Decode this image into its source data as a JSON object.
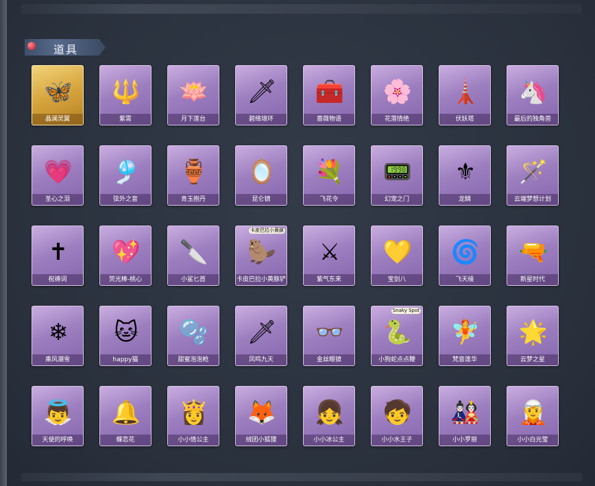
{
  "section": {
    "title": "道具"
  },
  "items": [
    {
      "label": "晶澜灵翼",
      "icon": "crystal-wings-icon",
      "glyph": "🦋",
      "rarity": "gold"
    },
    {
      "label": "紫霄",
      "icon": "pendant-icon",
      "glyph": "🔱",
      "rarity": "purple"
    },
    {
      "label": "月下莲台",
      "icon": "lotus-scepter-icon",
      "glyph": "🪷",
      "rarity": "purple"
    },
    {
      "label": "碧络琅环",
      "icon": "jade-sword-icon",
      "glyph": "🗡",
      "rarity": "purple"
    },
    {
      "label": "蔷薇物语",
      "icon": "rose-box-icon",
      "glyph": "🧰",
      "rarity": "purple"
    },
    {
      "label": "花落情绝",
      "icon": "flower-pendant-icon",
      "glyph": "🌸",
      "rarity": "purple"
    },
    {
      "label": "伏妖塔",
      "icon": "pagoda-icon",
      "glyph": "🗼",
      "rarity": "purple"
    },
    {
      "label": "最后的独角兽",
      "icon": "unicorn-horn-icon",
      "glyph": "🦄",
      "rarity": "purple"
    },
    {
      "label": "圣心之泪",
      "icon": "heart-scepter-icon",
      "glyph": "💗",
      "rarity": "purple"
    },
    {
      "label": "弦外之音",
      "icon": "flute-icon",
      "glyph": "🎐",
      "rarity": "purple"
    },
    {
      "label": "青玉抱丹",
      "icon": "jade-vase-icon",
      "glyph": "🏺",
      "rarity": "purple"
    },
    {
      "label": "昆仑镜",
      "icon": "mirror-icon",
      "glyph": "🪞",
      "rarity": "purple"
    },
    {
      "label": "飞花令",
      "icon": "flower-bouquet-icon",
      "glyph": "💐",
      "rarity": "purple"
    },
    {
      "label": "幻宠之门",
      "icon": "tamagotchi-icon",
      "glyph": "📟",
      "rarity": "purple"
    },
    {
      "label": "龙鳞",
      "icon": "golden-spade-icon",
      "glyph": "⚜",
      "rarity": "purple"
    },
    {
      "label": "云端梦想计划",
      "icon": "crystal-wand-icon",
      "glyph": "🪄",
      "rarity": "purple"
    },
    {
      "label": "祝祷词",
      "icon": "golden-cross-icon",
      "glyph": "✝",
      "rarity": "purple"
    },
    {
      "label": "荧光棒-桃心",
      "icon": "heart-glowstick-icon",
      "glyph": "💖",
      "rarity": "purple"
    },
    {
      "label": "小鲨匕首",
      "icon": "shark-dagger-icon",
      "glyph": "🔪",
      "rarity": "purple"
    },
    {
      "label": "卡皮巴拉小黄豚铲",
      "icon": "capybara-shovel-icon",
      "glyph": "🦫",
      "rarity": "purple",
      "badge": "卡皮巴拉小黄豚"
    },
    {
      "label": "紫气东来",
      "icon": "curved-sword-icon",
      "glyph": "⚔",
      "rarity": "purple"
    },
    {
      "label": "宝剑八",
      "icon": "heart-card-icon",
      "glyph": "💛",
      "rarity": "purple"
    },
    {
      "label": "飞天绫",
      "icon": "ribbon-whip-icon",
      "glyph": "🌀",
      "rarity": "purple"
    },
    {
      "label": "新星时代",
      "icon": "revolver-icon",
      "glyph": "🔫",
      "rarity": "purple"
    },
    {
      "label": "乘风潮雪",
      "icon": "ice-wings-icon",
      "glyph": "❄",
      "rarity": "purple"
    },
    {
      "label": "happy猫",
      "icon": "happy-cat-icon",
      "glyph": "🐱",
      "rarity": "purple"
    },
    {
      "label": "甜蜜泡泡枪",
      "icon": "bubble-gun-icon",
      "glyph": "🫧",
      "rarity": "purple"
    },
    {
      "label": "凤鸣九天",
      "icon": "phoenix-blade-icon",
      "glyph": "🗡",
      "rarity": "purple"
    },
    {
      "label": "金丝眼镜",
      "icon": "glasses-icon",
      "glyph": "👓",
      "rarity": "purple"
    },
    {
      "label": "小狗蛇点点鞭",
      "icon": "snake-whip-icon",
      "glyph": "🐍",
      "rarity": "purple",
      "badge": "Snaky Spot"
    },
    {
      "label": "梵音莲华",
      "icon": "lotus-doll-icon",
      "glyph": "🧚",
      "rarity": "purple"
    },
    {
      "label": "云梦之星",
      "icon": "unicorn-star-icon",
      "glyph": "🌟",
      "rarity": "purple"
    },
    {
      "label": "天使的呼唤",
      "icon": "angel-doll-icon",
      "glyph": "👼",
      "rarity": "purple"
    },
    {
      "label": "蝶恋花",
      "icon": "butterfly-bell-icon",
      "glyph": "🔔",
      "rarity": "purple"
    },
    {
      "label": "小小情公主",
      "icon": "pink-princess-icon",
      "glyph": "👸",
      "rarity": "purple"
    },
    {
      "label": "绒团小狐狸",
      "icon": "fox-plush-icon",
      "glyph": "🦊",
      "rarity": "purple"
    },
    {
      "label": "小小冰公主",
      "icon": "ice-princess-icon",
      "glyph": "👧",
      "rarity": "purple"
    },
    {
      "label": "小小水王子",
      "icon": "water-prince-icon",
      "glyph": "🧒",
      "rarity": "purple"
    },
    {
      "label": "小小罗丽",
      "icon": "loli-doll-icon",
      "glyph": "🎎",
      "rarity": "purple"
    },
    {
      "label": "小小白光莹",
      "icon": "white-light-doll-icon",
      "glyph": "🧝",
      "rarity": "purple"
    }
  ]
}
